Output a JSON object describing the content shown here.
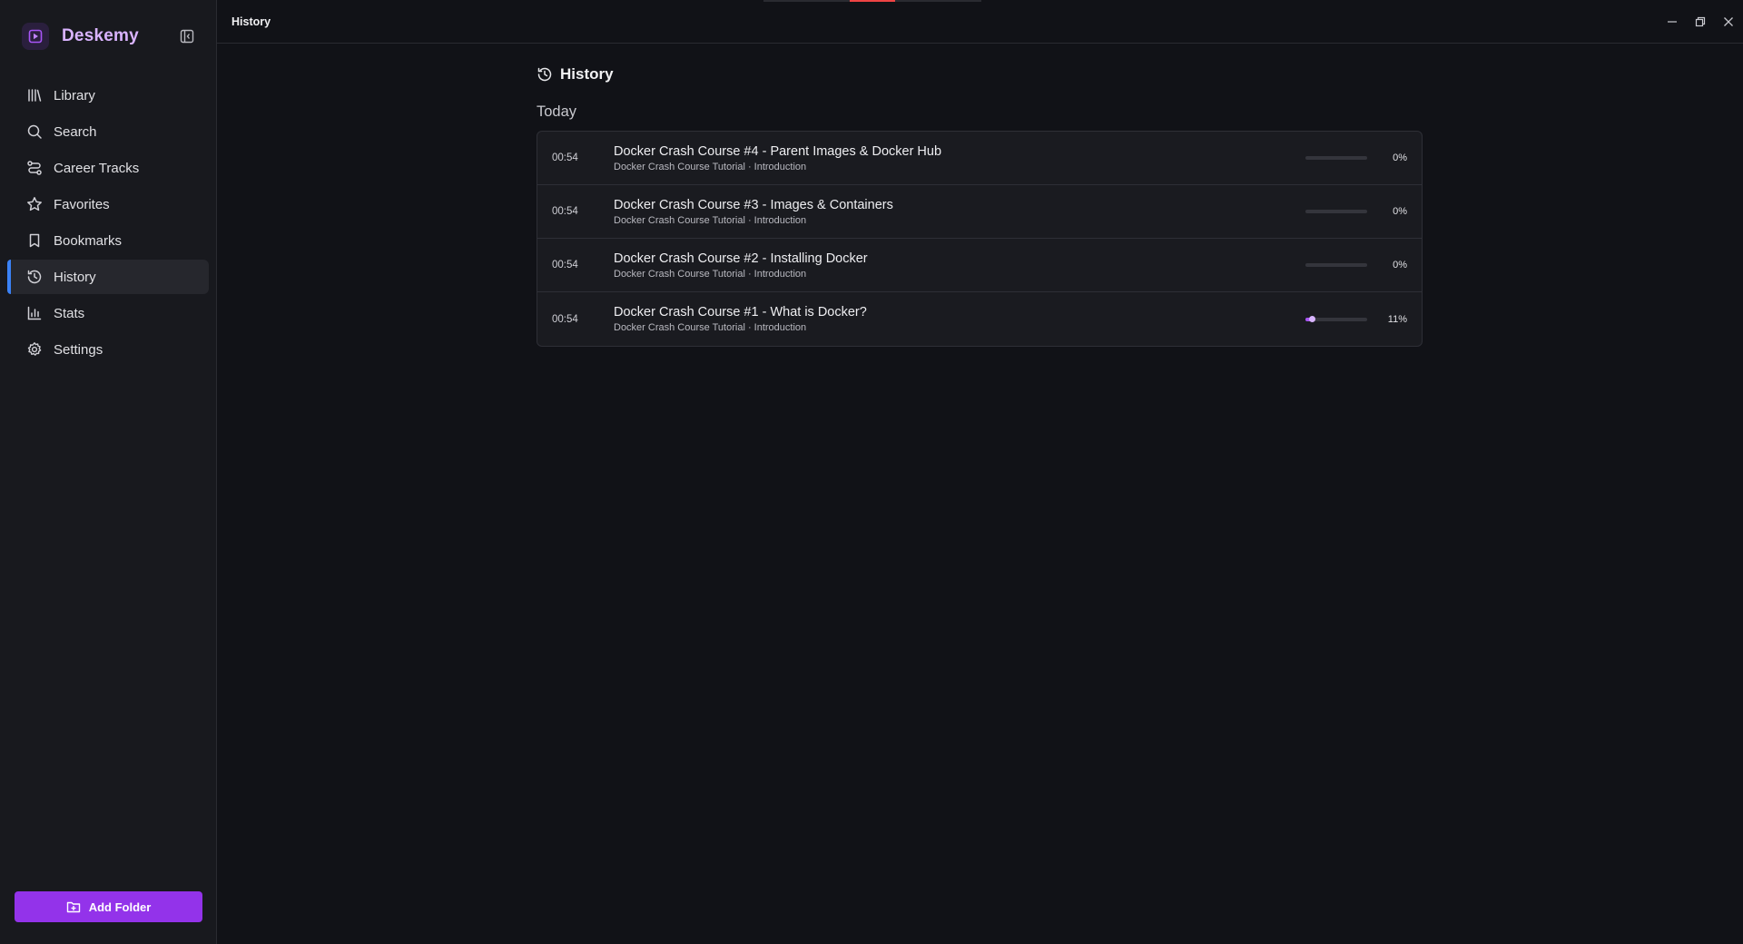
{
  "app": {
    "name": "Deskemy",
    "window_title": "History"
  },
  "colors": {
    "accent": "#9333ea",
    "brand_text": "#d9b3ff",
    "active_indicator": "#3b82f6",
    "progress": "#a855f7"
  },
  "sidebar": {
    "items": [
      {
        "label": "Library",
        "icon": "library-icon",
        "active": false
      },
      {
        "label": "Search",
        "icon": "search-icon",
        "active": false
      },
      {
        "label": "Career Tracks",
        "icon": "route-icon",
        "active": false
      },
      {
        "label": "Favorites",
        "icon": "star-icon",
        "active": false
      },
      {
        "label": "Bookmarks",
        "icon": "bookmark-icon",
        "active": false
      },
      {
        "label": "History",
        "icon": "history-icon",
        "active": true
      },
      {
        "label": "Stats",
        "icon": "bar-chart-icon",
        "active": false
      },
      {
        "label": "Settings",
        "icon": "gear-icon",
        "active": false
      }
    ],
    "add_folder_label": "Add Folder"
  },
  "page": {
    "title": "History",
    "group_label": "Today",
    "entries": [
      {
        "time": "00:54",
        "title": "Docker Crash Course #4 - Parent Images & Docker Hub",
        "subtitle": "Docker Crash Course Tutorial · Introduction",
        "progress": 0,
        "progress_label": "0%"
      },
      {
        "time": "00:54",
        "title": "Docker Crash Course #3 - Images & Containers",
        "subtitle": "Docker Crash Course Tutorial · Introduction",
        "progress": 0,
        "progress_label": "0%"
      },
      {
        "time": "00:54",
        "title": "Docker Crash Course #2 - Installing Docker",
        "subtitle": "Docker Crash Course Tutorial · Introduction",
        "progress": 0,
        "progress_label": "0%"
      },
      {
        "time": "00:54",
        "title": "Docker Crash Course #1 - What is Docker?",
        "subtitle": "Docker Crash Course Tutorial · Introduction",
        "progress": 11,
        "progress_label": "11%"
      }
    ]
  }
}
